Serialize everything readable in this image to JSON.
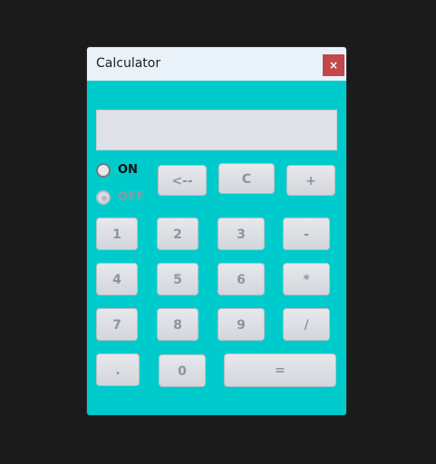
{
  "window": {
    "title": "Calculator",
    "close_label": "×"
  },
  "display": {
    "value": ""
  },
  "power": {
    "on_label": "ON",
    "off_label": "OFF"
  },
  "buttons": {
    "backspace": "<--",
    "clear": "C",
    "plus": "+",
    "one": "1",
    "two": "2",
    "three": "3",
    "minus": "-",
    "four": "4",
    "five": "5",
    "six": "6",
    "multiply": "*",
    "seven": "7",
    "eight": "8",
    "nine": "9",
    "divide": "/",
    "dot": ".",
    "zero": "0",
    "equals": "="
  }
}
